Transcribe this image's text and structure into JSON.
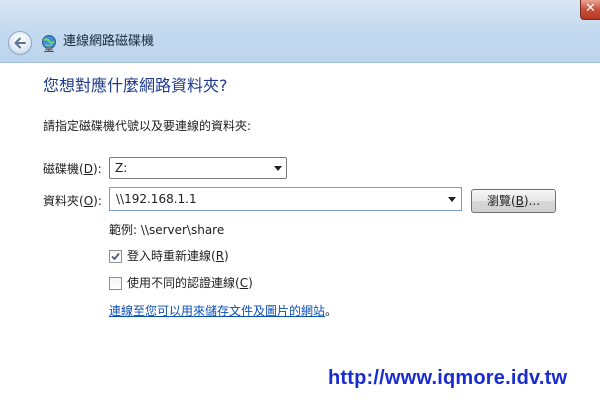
{
  "window": {
    "title": "連線網路磁碟機",
    "close_glyph": "✕"
  },
  "page": {
    "heading": "您想對應什麼網路資料夾?",
    "instruction": "請指定磁碟機代號以及要連線的資料夾:"
  },
  "drive": {
    "label": "磁碟機(",
    "accel": "D",
    "label_end": "):",
    "value": "Z:"
  },
  "folder": {
    "label": "資料夾(",
    "accel": "O",
    "label_end": "):",
    "value": "\\\\192.168.1.1"
  },
  "browse": {
    "label": "瀏覽(",
    "accel": "B",
    "label_end": ")..."
  },
  "example": "範例: \\\\server\\share",
  "reconnect": {
    "label": "登入時重新連線(",
    "accel": "R",
    "label_end": ")",
    "checked": true
  },
  "different_credentials": {
    "label": "使用不同的認證連線(",
    "accel": "C",
    "label_end": ")",
    "checked": false
  },
  "storage_link": {
    "text": "連線至您可以用來儲存文件及圖片的網站",
    "suffix": "。"
  },
  "watermark": "http://www.iqmore.idv.tw",
  "colors": {
    "heading": "#1e3a8a",
    "link": "#0a4fb4",
    "watermark": "#1a2bd0",
    "close": "#c9503a"
  }
}
